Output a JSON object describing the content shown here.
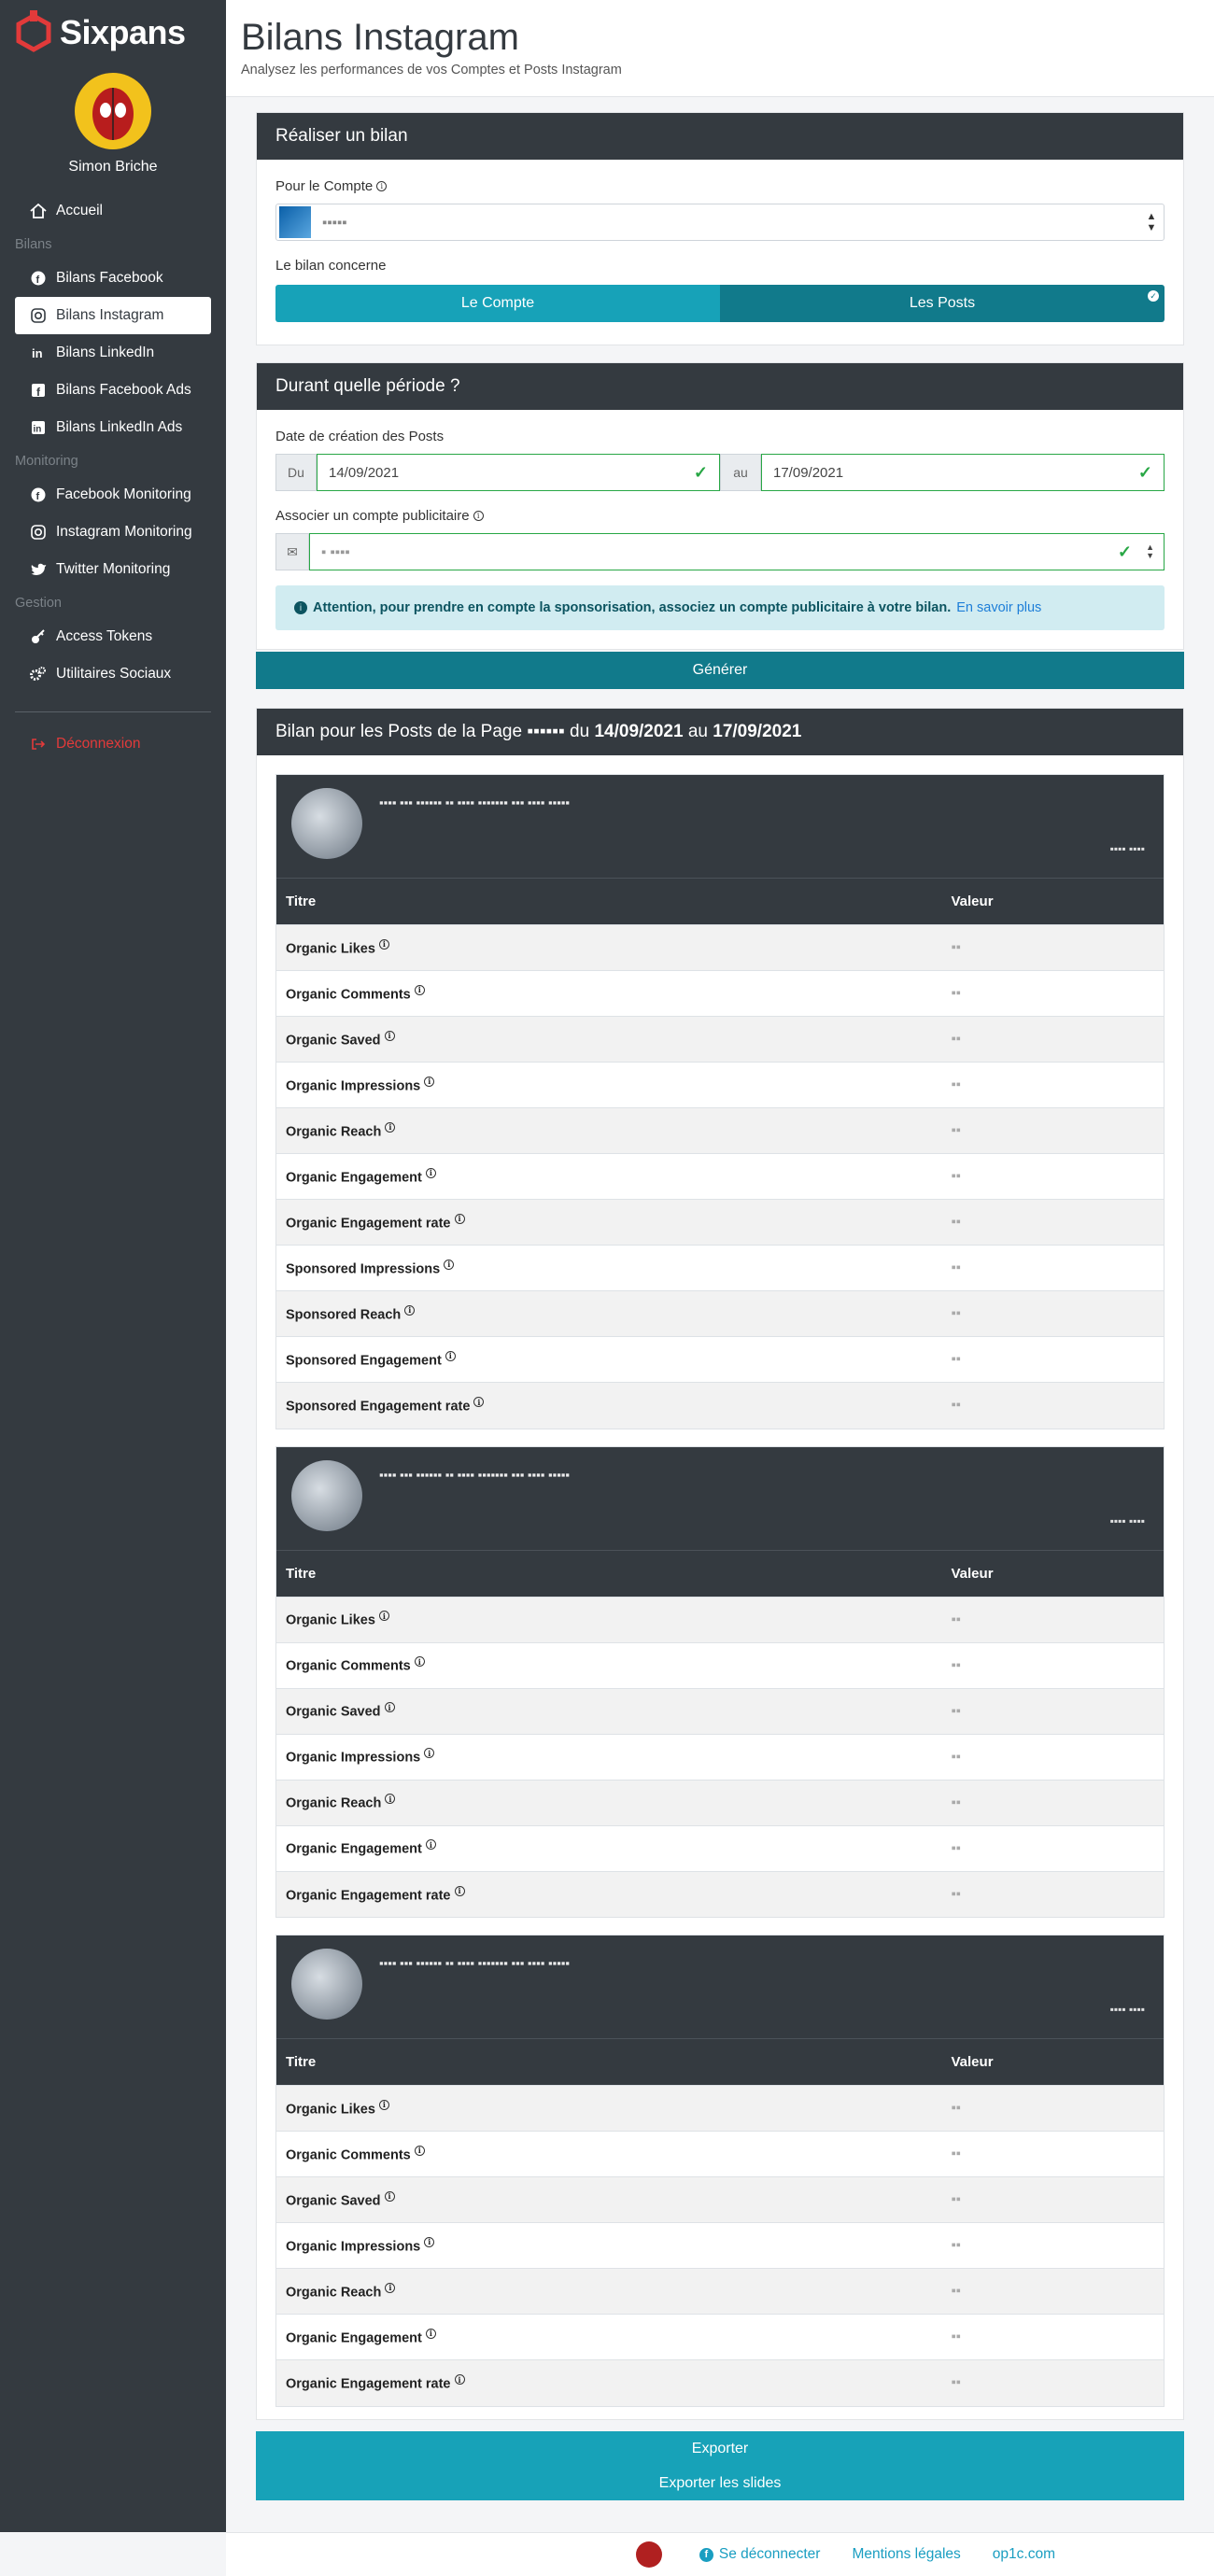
{
  "brand": {
    "name": "Sixpans"
  },
  "user": {
    "name": "Simon Briche"
  },
  "nav": {
    "home": "Accueil",
    "section_bilans": "Bilans",
    "bilans": [
      "Bilans Facebook",
      "Bilans Instagram",
      "Bilans LinkedIn",
      "Bilans Facebook Ads",
      "Bilans LinkedIn Ads"
    ],
    "section_monitoring": "Monitoring",
    "monitoring": [
      "Facebook Monitoring",
      "Instagram Monitoring",
      "Twitter Monitoring"
    ],
    "section_gestion": "Gestion",
    "gestion": [
      "Access Tokens",
      "Utilitaires Sociaux"
    ],
    "logout": "Déconnexion"
  },
  "header": {
    "title": "Bilans Instagram",
    "subtitle": "Analysez les performances de vos Comptes et Posts Instagram"
  },
  "form": {
    "title": "Réaliser un bilan",
    "account_label": "Pour le Compte",
    "scope_label": "Le bilan concerne",
    "scope_options": [
      "Le Compte",
      "Les Posts"
    ]
  },
  "period": {
    "title": "Durant quelle période ?",
    "date_label": "Date de création des Posts",
    "from_addon": "Du",
    "from_value": "14/09/2021",
    "to_addon": "au",
    "to_value": "17/09/2021",
    "ad_account_label": "Associer un compte publicitaire",
    "alert_bold": "Attention, pour prendre en compte la sponsorisation, associez un compte publicitaire à votre bilan.",
    "alert_link": "En savoir plus"
  },
  "generate_label": "Générer",
  "report": {
    "title_prefix": "Bilan pour les Posts de la Page",
    "title_du": "du",
    "title_from": "14/09/2021",
    "title_au": "au",
    "title_to": "17/09/2021",
    "col_title": "Titre",
    "col_value": "Valeur",
    "posts": [
      {
        "rows": [
          "Organic Likes",
          "Organic Comments",
          "Organic Saved",
          "Organic Impressions",
          "Organic Reach",
          "Organic Engagement",
          "Organic Engagement rate",
          "Sponsored Impressions",
          "Sponsored Reach",
          "Sponsored Engagement",
          "Sponsored Engagement rate"
        ]
      },
      {
        "rows": [
          "Organic Likes",
          "Organic Comments",
          "Organic Saved",
          "Organic Impressions",
          "Organic Reach",
          "Organic Engagement",
          "Organic Engagement rate"
        ]
      },
      {
        "rows": [
          "Organic Likes",
          "Organic Comments",
          "Organic Saved",
          "Organic Impressions",
          "Organic Reach",
          "Organic Engagement",
          "Organic Engagement rate"
        ]
      }
    ]
  },
  "export": {
    "export_label": "Exporter",
    "export_slides_label": "Exporter les slides"
  },
  "footer": {
    "logout": "Se déconnecter",
    "legal": "Mentions légales",
    "site": "op1c.com"
  },
  "colors": {
    "sidebar": "#343a40",
    "accent": "#17a2b8",
    "accent_dark": "#117a8b",
    "brand": "#e23a3a",
    "success": "#28a745"
  }
}
